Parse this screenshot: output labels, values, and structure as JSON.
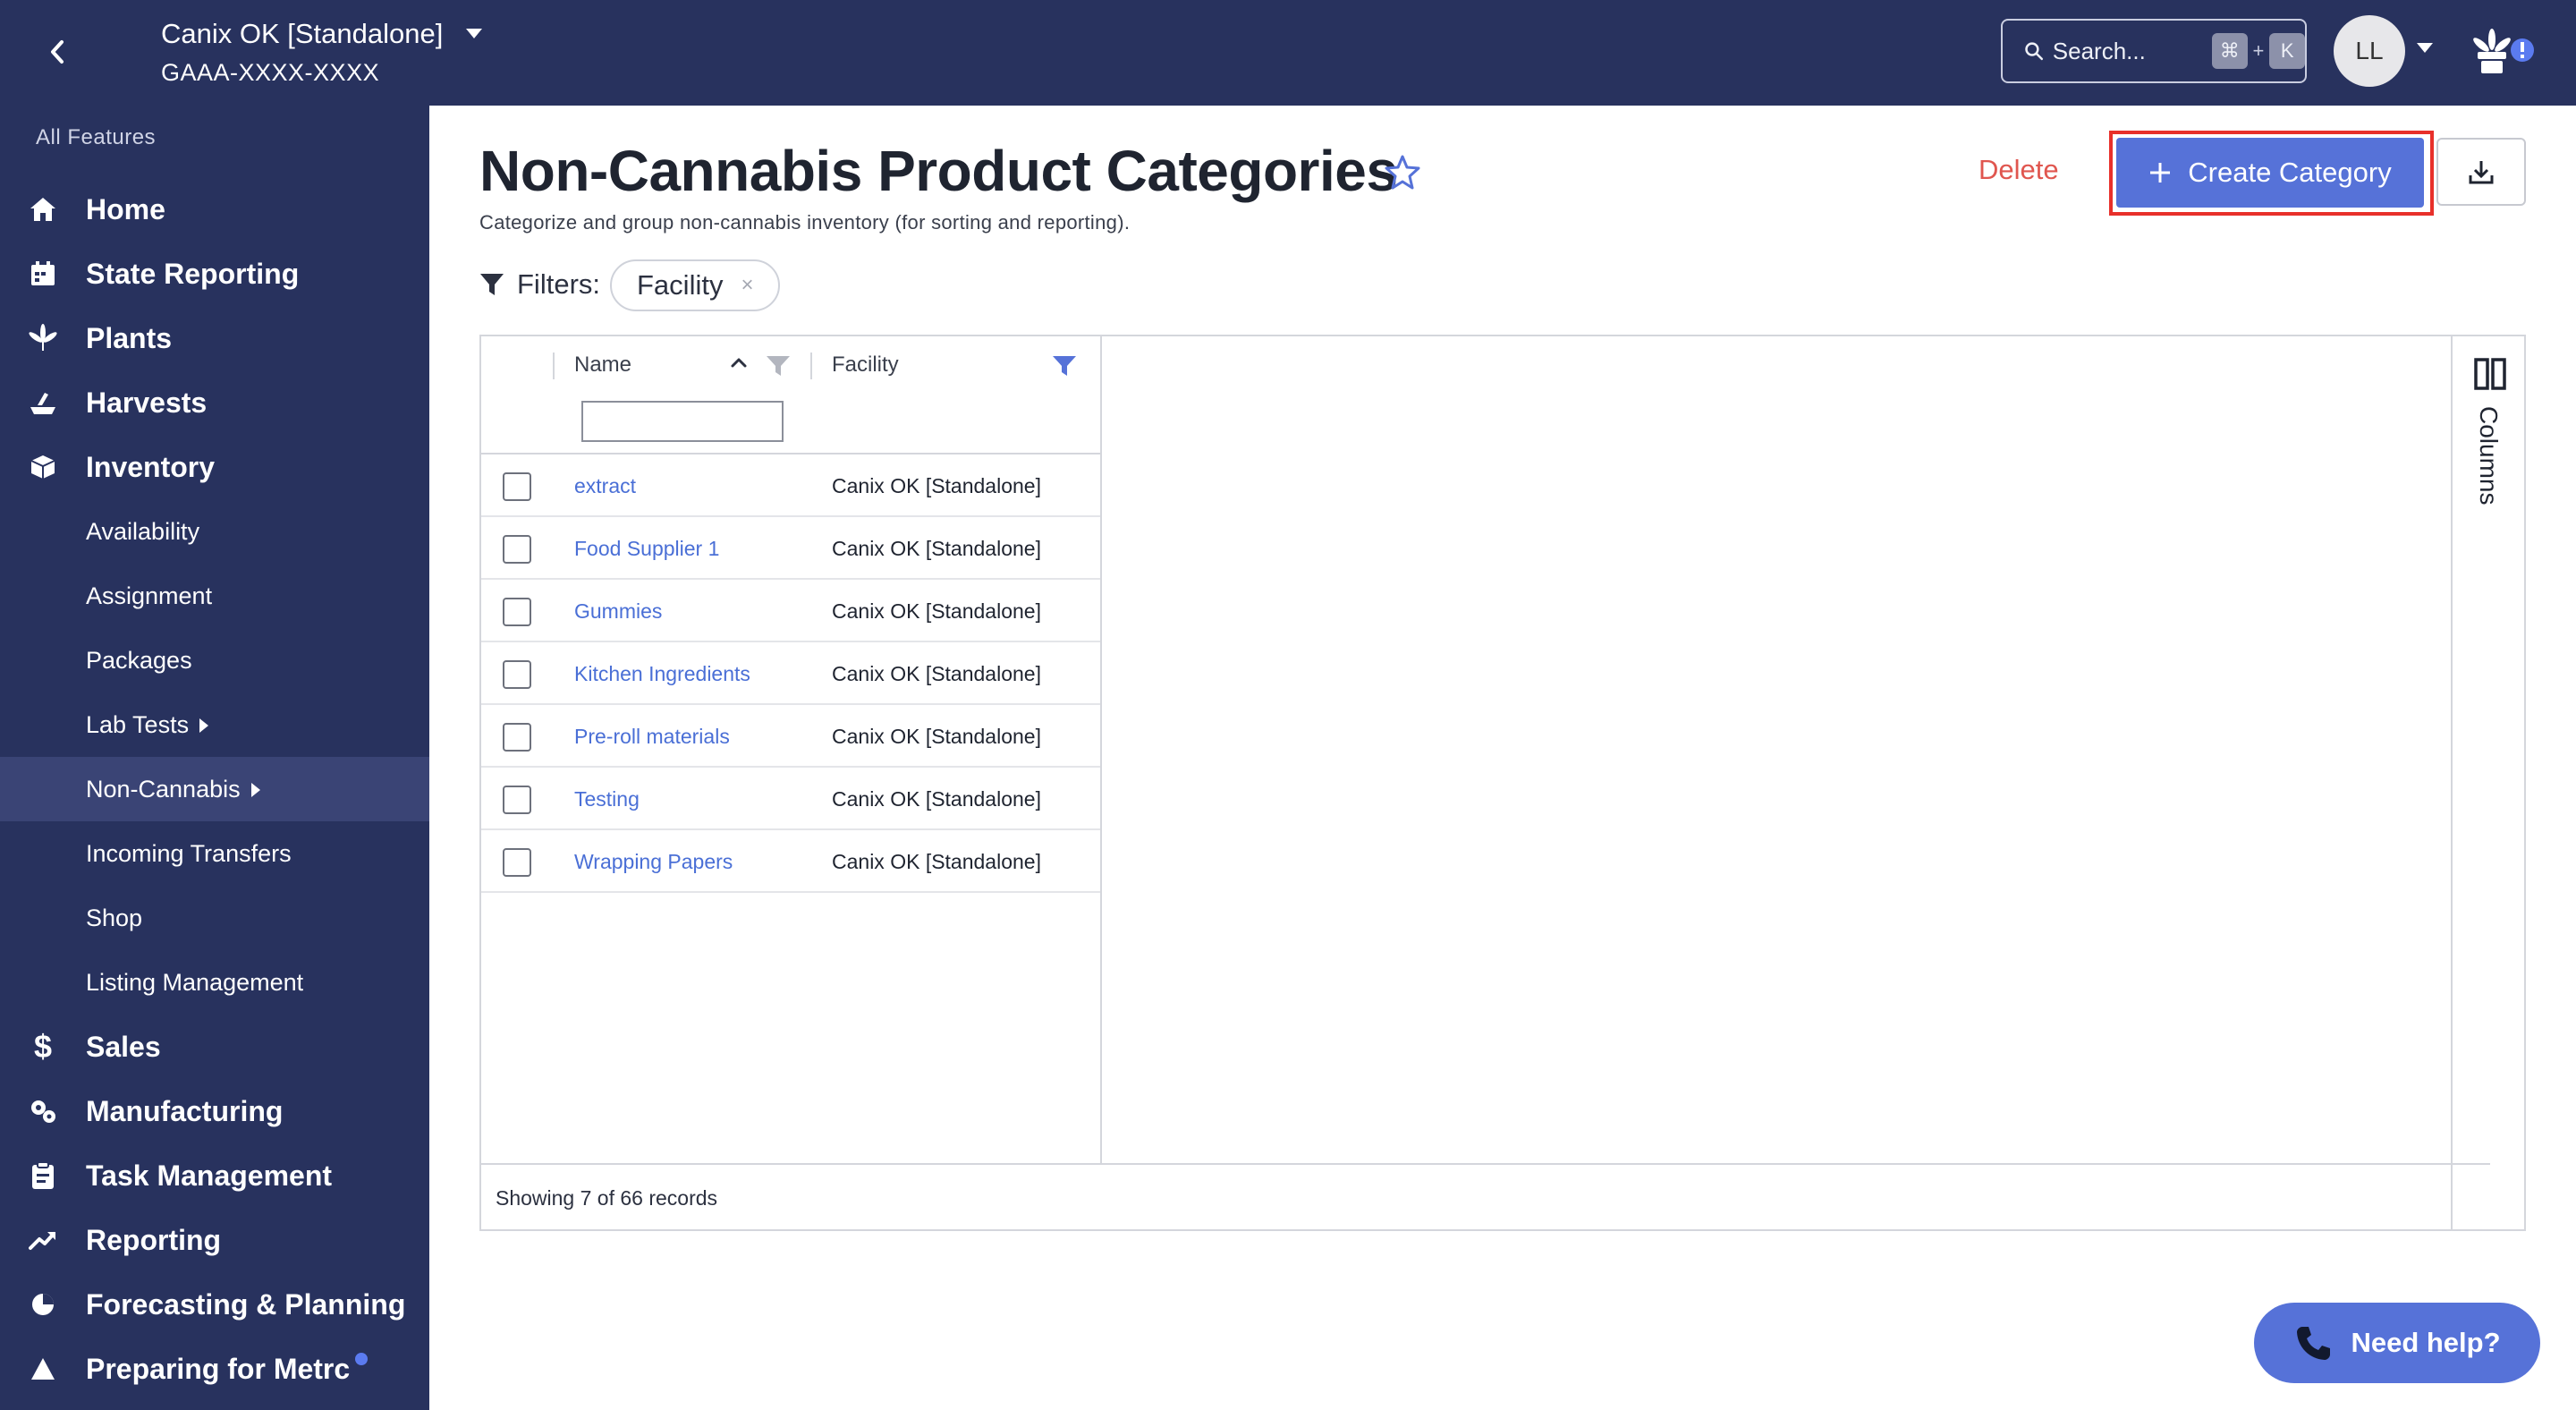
{
  "header": {
    "facility_name": "Canix OK [Standalone]",
    "facility_license": "GAAA-XXXX-XXXX",
    "search_placeholder": "Search...",
    "shortcut_cmd": "⌘",
    "shortcut_plus": "+",
    "shortcut_key": "K",
    "avatar_initials": "LL"
  },
  "sidebar": {
    "heading": "All Features",
    "items": [
      {
        "label": "Home",
        "icon": "home-icon"
      },
      {
        "label": "State Reporting",
        "icon": "calendar-icon"
      },
      {
        "label": "Plants",
        "icon": "leaf-icon"
      },
      {
        "label": "Harvests",
        "icon": "harvest-icon"
      },
      {
        "label": "Inventory",
        "icon": "box-icon"
      },
      {
        "label": "Availability"
      },
      {
        "label": "Assignment"
      },
      {
        "label": "Packages"
      },
      {
        "label": "Lab Tests"
      },
      {
        "label": "Non-Cannabis"
      },
      {
        "label": "Incoming Transfers"
      },
      {
        "label": "Shop"
      },
      {
        "label": "Listing Management"
      },
      {
        "label": "Sales",
        "icon": "dollar-icon"
      },
      {
        "label": "Manufacturing",
        "icon": "gears-icon"
      },
      {
        "label": "Task Management",
        "icon": "clipboard-icon"
      },
      {
        "label": "Reporting",
        "icon": "trend-icon"
      },
      {
        "label": "Forecasting & Planning",
        "icon": "pie-icon"
      },
      {
        "label": "Preparing for Metrc",
        "icon": "triangle-icon"
      }
    ]
  },
  "page": {
    "title": "Non-Cannabis Product Categories",
    "subtitle": "Categorize and group non-cannabis inventory (for sorting and reporting).",
    "delete_label": "Delete",
    "create_label": "Create Category",
    "filters_label": "Filters:",
    "filter_chip": "Facility",
    "filter_chip_remove": "×"
  },
  "grid": {
    "columns": {
      "name": "Name",
      "facility": "Facility"
    },
    "name_filter_value": "",
    "rows": [
      {
        "name": "extract",
        "facility": "Canix OK [Standalone]"
      },
      {
        "name": "Food Supplier 1",
        "facility": "Canix OK [Standalone]"
      },
      {
        "name": "Gummies",
        "facility": "Canix OK [Standalone]"
      },
      {
        "name": "Kitchen Ingredients",
        "facility": "Canix OK [Standalone]"
      },
      {
        "name": "Pre-roll materials",
        "facility": "Canix OK [Standalone]"
      },
      {
        "name": "Testing",
        "facility": "Canix OK [Standalone]"
      },
      {
        "name": "Wrapping Papers",
        "facility": "Canix OK [Standalone]"
      }
    ],
    "record_count": "Showing 7 of 66 records",
    "columns_panel_label": "Columns"
  },
  "help": {
    "label": "Need help?"
  },
  "colors": {
    "navy": "#28325e",
    "accent": "#5672d8",
    "danger": "#e0564f",
    "link": "#4a6fd6",
    "highlight_outline": "#e8302a"
  }
}
